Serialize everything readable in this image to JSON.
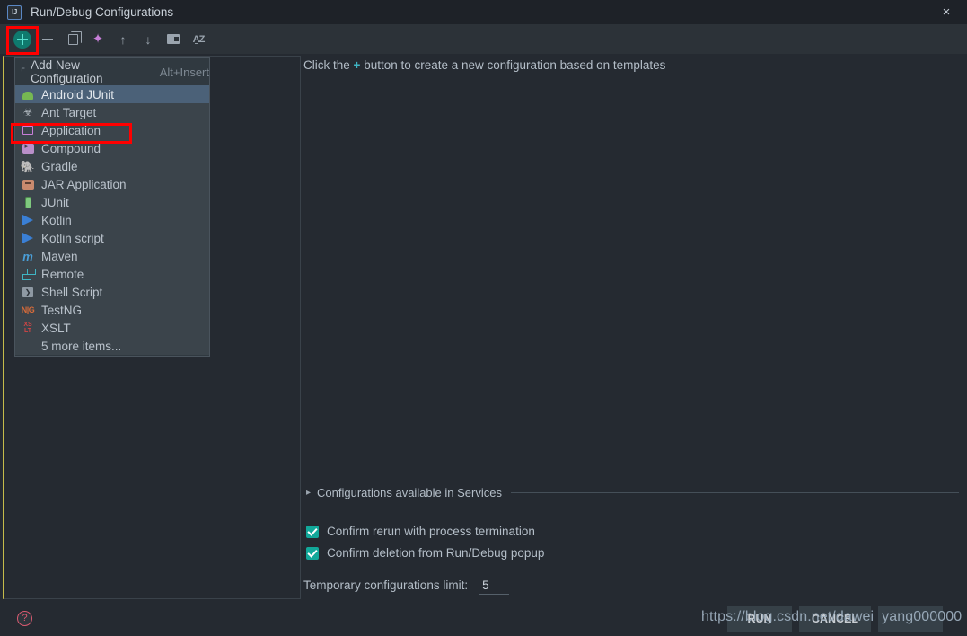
{
  "window": {
    "title": "Run/Debug Configurations",
    "app_icon": "IJ",
    "close_icon": "×"
  },
  "toolbar": {
    "buttons": [
      {
        "name": "add",
        "icon": "plus-icon",
        "glyph": ""
      },
      {
        "name": "remove",
        "icon": "minus-icon",
        "glyph": ""
      },
      {
        "name": "copy",
        "icon": "copy-icon",
        "glyph": ""
      },
      {
        "name": "edit-templates",
        "icon": "gear-icon",
        "glyph": "✿"
      },
      {
        "name": "move-up",
        "icon": "arrow-up-icon",
        "glyph": "↑"
      },
      {
        "name": "move-down",
        "icon": "arrow-down-icon",
        "glyph": "↓"
      },
      {
        "name": "new-folder",
        "icon": "folder-plus-icon",
        "glyph": ""
      },
      {
        "name": "sort",
        "icon": "sort-alphabetical-icon",
        "glyph": "A̦Z"
      }
    ]
  },
  "popup": {
    "tooltip": {
      "caret": "⌐",
      "label": "Add New Configuration",
      "shortcut": "Alt+Insert"
    },
    "items": [
      {
        "label": "Android JUnit",
        "icon": "android-icon",
        "selected": true
      },
      {
        "label": "Ant Target",
        "icon": "ant-icon",
        "selected": false
      },
      {
        "label": "Application",
        "icon": "application-icon",
        "selected": false
      },
      {
        "label": "Compound",
        "icon": "compound-icon",
        "selected": false
      },
      {
        "label": "Gradle",
        "icon": "gradle-icon",
        "selected": false
      },
      {
        "label": "JAR Application",
        "icon": "jar-icon",
        "selected": false
      },
      {
        "label": "JUnit",
        "icon": "junit-icon",
        "selected": false
      },
      {
        "label": "Kotlin",
        "icon": "kotlin-icon",
        "selected": false
      },
      {
        "label": "Kotlin script",
        "icon": "kotlin-script-icon",
        "selected": false
      },
      {
        "label": "Maven",
        "icon": "maven-icon",
        "selected": false
      },
      {
        "label": "Remote",
        "icon": "remote-icon",
        "selected": false
      },
      {
        "label": "Shell Script",
        "icon": "shell-script-icon",
        "selected": false
      },
      {
        "label": "TestNG",
        "icon": "testng-icon",
        "selected": false
      },
      {
        "label": "XSLT",
        "icon": "xslt-icon",
        "selected": false
      },
      {
        "label": "5 more items...",
        "icon": "",
        "selected": false
      }
    ]
  },
  "main": {
    "hint_prefix": "Click the",
    "hint_plus": "+",
    "hint_suffix": "button to create a new configuration based on templates",
    "services_section_label": "Configurations available in Services",
    "services_caret": "▸",
    "checkboxes": [
      {
        "label": "Confirm rerun with process termination",
        "checked": true
      },
      {
        "label": "Confirm deletion from Run/Debug popup",
        "checked": true
      }
    ],
    "temporary_limit_label": "Temporary configurations limit:",
    "temporary_limit_value": "5"
  },
  "footer": {
    "help_glyph": "?",
    "buttons": [
      {
        "label": "RUN"
      },
      {
        "label": "CANCEL"
      },
      {
        "label": ""
      }
    ],
    "watermark": "https://blog.csdn.net/dawei_yang000000"
  },
  "annotations": {
    "add_button_highlight_color": "#ff0000",
    "application_row_highlight_color": "#ff0000"
  },
  "colors": {
    "dialog_background": "#252a31",
    "titlebar_background": "#1e2228",
    "toolbar_background": "#2c3238",
    "popup_background": "#3b444b",
    "selection": "#4b6178",
    "accent_teal": "#12a89a",
    "accent_left_border": "#c5bb4a",
    "text_primary": "#b4bec8"
  }
}
